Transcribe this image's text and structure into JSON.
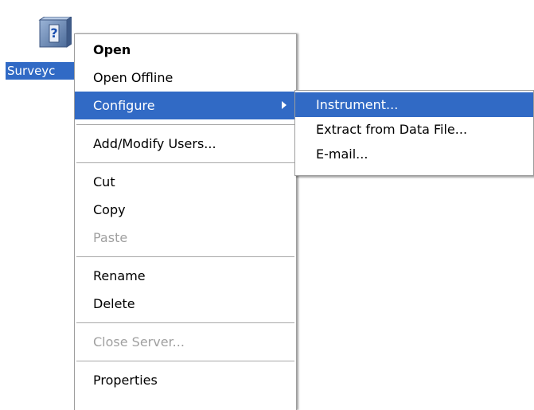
{
  "desktop_icon": {
    "glyph_label": "?",
    "caption": "Surveyc"
  },
  "context_menu": {
    "items": [
      {
        "label": "Open",
        "bold": true
      },
      {
        "label": "Open Offline"
      },
      {
        "label": "Configure",
        "has_submenu": true,
        "highlighted": true
      },
      {
        "label": "Add/Modify Users..."
      },
      {
        "label": "Cut"
      },
      {
        "label": "Copy"
      },
      {
        "label": "Paste",
        "disabled": true
      },
      {
        "label": "Rename"
      },
      {
        "label": "Delete"
      },
      {
        "label": "Close Server...",
        "disabled": true
      },
      {
        "label": "Properties"
      }
    ]
  },
  "submenu": {
    "items": [
      {
        "label": "Instrument...",
        "highlighted": true
      },
      {
        "label": "Extract from Data File..."
      },
      {
        "label": "E-mail..."
      }
    ]
  },
  "colors": {
    "selection": "#316ac5",
    "disabled_text": "#a0a0a0",
    "menu_border": "#9d9d9d"
  }
}
